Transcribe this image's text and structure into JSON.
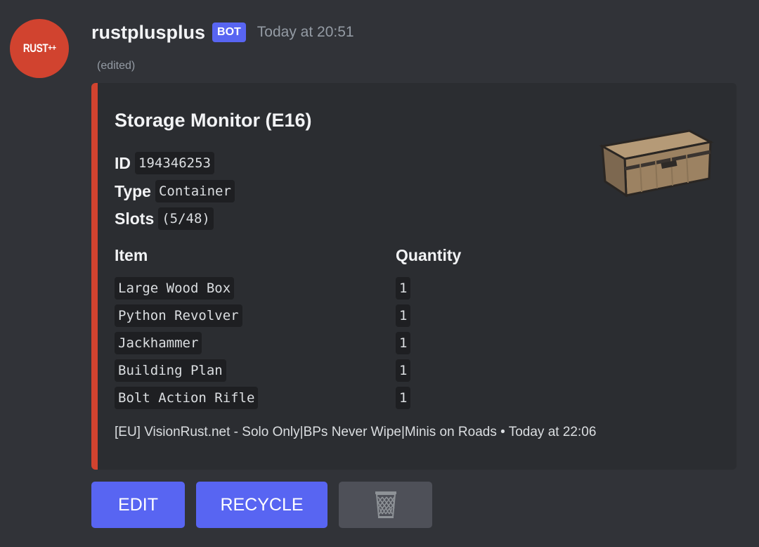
{
  "message": {
    "avatar": {
      "text": "RUST",
      "suffix": "++",
      "color": "#d1432f"
    },
    "username": "rustplusplus",
    "badge": "BOT",
    "timestamp": "Today at 20:51",
    "edited_label": "(edited)"
  },
  "embed": {
    "accent_color": "#d1432f",
    "title": "Storage Monitor (E16)",
    "fields": [
      {
        "name": "ID",
        "value": "194346253"
      },
      {
        "name": "Type",
        "value": "Container"
      },
      {
        "name": "Slots",
        "value": "(5/48)"
      }
    ],
    "thumbnail_icon": "large-wood-box-icon",
    "table": {
      "headers": [
        "Item",
        "Quantity"
      ],
      "rows": [
        {
          "item": "Large Wood Box",
          "quantity": "1"
        },
        {
          "item": "Python Revolver",
          "quantity": "1"
        },
        {
          "item": "Jackhammer",
          "quantity": "1"
        },
        {
          "item": "Building Plan",
          "quantity": "1"
        },
        {
          "item": "Bolt Action Rifle",
          "quantity": "1"
        }
      ]
    },
    "footer": {
      "text": "[EU] VisionRust.net - Solo Only|BPs Never Wipe|Minis on Roads",
      "separator": "•",
      "timestamp": "Today at 22:06"
    }
  },
  "buttons": [
    {
      "label": "EDIT",
      "style": "primary",
      "color": "#5865f2"
    },
    {
      "label": "RECYCLE",
      "style": "primary",
      "color": "#5865f2"
    },
    {
      "label": "",
      "icon": "trash-bin-icon",
      "style": "secondary",
      "color": "#4e5058"
    }
  ]
}
